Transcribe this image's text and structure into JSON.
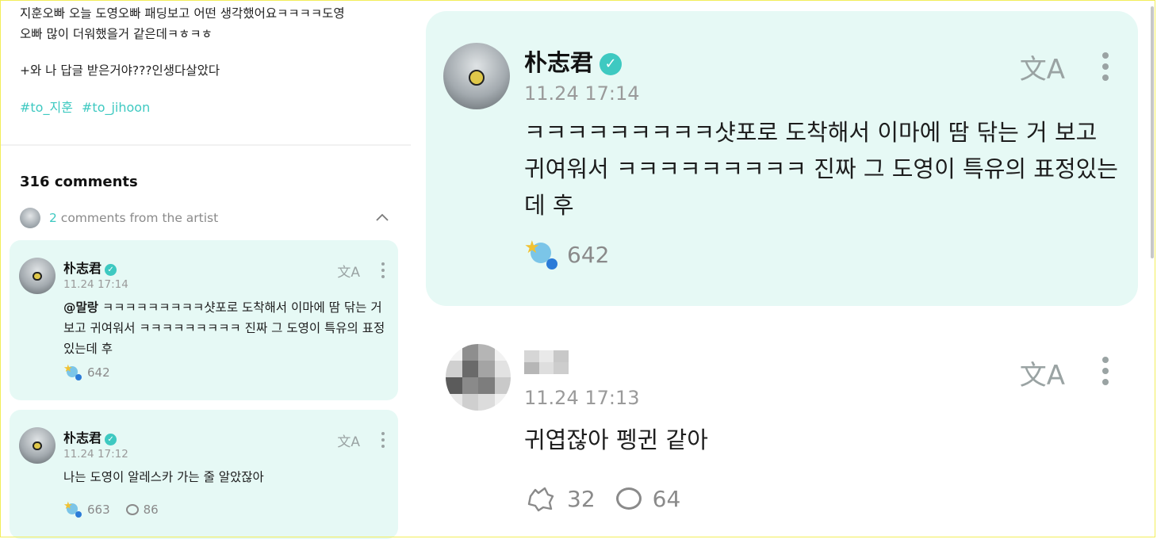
{
  "post": {
    "lines": [
      "지훈오빠 오늘 도영오빠 패딩보고 어떤 생각했어요ㅋㅋㅋㅋ도영",
      "오빠 많이 더워했을거 같은데ㅋㅎㅋㅎ",
      "+와 나 답글 받은거야???인생다살았다"
    ],
    "hashtags": [
      "#to_지훈",
      "#to_jihoon"
    ]
  },
  "comments_header": {
    "count_label": "316 comments",
    "artist_count": "2",
    "artist_label": " comments from the artist"
  },
  "colors": {
    "accent": "#3ec9c1",
    "card_bg": "#e6f9f5",
    "muted": "#9a9a9a"
  },
  "left_cards": [
    {
      "name": "朴志君",
      "time": "11.24 17:14",
      "mention": "@말랑",
      "body": " ㅋㅋㅋㅋㅋㅋㅋㅋㅋ샷포로 도착해서 이마에 땀 닦는 거 보고 귀여워서 ㅋㅋㅋㅋㅋㅋㅋㅋㅋ 진짜 그 도영이 특유의 표정있는데 후",
      "reactions": "642"
    },
    {
      "name": "朴志君",
      "time": "11.24 17:12",
      "body": "나는 도영이 알레스카 가는 줄 알았잖아",
      "reactions": "663",
      "replies": "86"
    }
  ],
  "focus_card": {
    "name": "朴志君",
    "time": "11.24 17:14",
    "body": "ㅋㅋㅋㅋㅋㅋㅋㅋㅋ샷포로 도착해서 이마에 땀 닦는 거 보고 귀여워서 ㅋㅋㅋㅋㅋㅋㅋㅋㅋ 진짜 그 도영이 특유의 표정있는데 후",
    "reactions": "642"
  },
  "reply": {
    "time": "11.24 17:13",
    "body": "귀엽잖아 펭귄 같아",
    "reactions": "32",
    "replies": "64"
  },
  "icons": {
    "translate": "translate-icon",
    "more": "more-vertical-icon",
    "verified": "verified-badge-icon",
    "reaction": "reaction-icon",
    "reply": "comment-bubble-icon",
    "collapse": "chevron-up-icon"
  },
  "glyphs": {
    "translate": "文A",
    "verified": "✓",
    "star": "★"
  }
}
